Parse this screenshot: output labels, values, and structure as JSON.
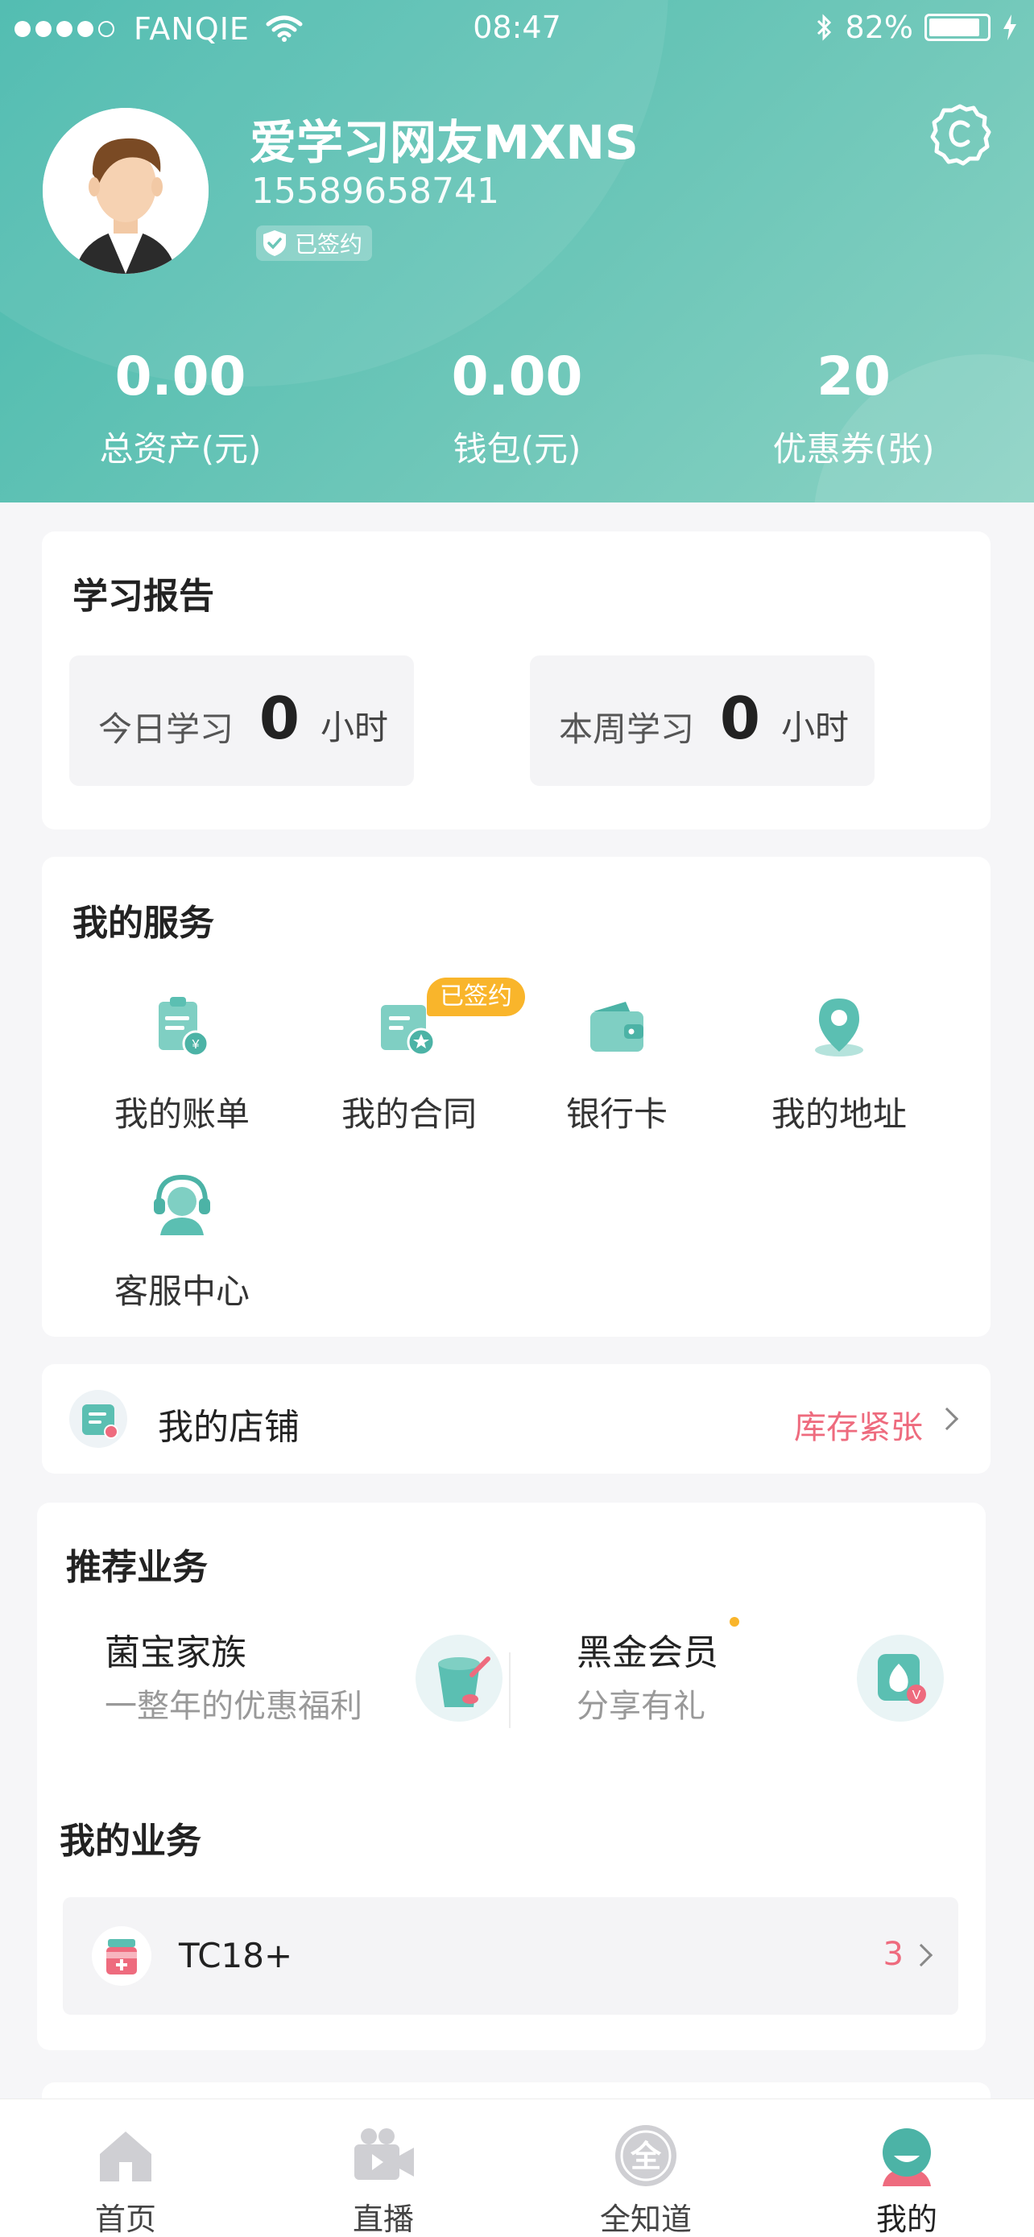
{
  "status_bar": {
    "carrier": "FANQIE",
    "time": "08:47",
    "battery": "82%"
  },
  "profile": {
    "name": "爱学习网友MXNS",
    "phone": "15589658741",
    "badge": "已签约"
  },
  "stats": [
    {
      "value": "0.00",
      "label": "总资产(元)"
    },
    {
      "value": "0.00",
      "label": "钱包(元)"
    },
    {
      "value": "20",
      "label": "优惠券(张)"
    }
  ],
  "study_report": {
    "title": "学习报告",
    "today": {
      "label": "今日学习",
      "value": "0",
      "unit": "小时"
    },
    "week": {
      "label": "本周学习",
      "value": "0",
      "unit": "小时"
    }
  },
  "services": {
    "title": "我的服务",
    "signed_tag": "已签约",
    "items": [
      {
        "label": "我的账单",
        "icon": "bill-icon"
      },
      {
        "label": "我的合同",
        "icon": "contract-icon"
      },
      {
        "label": "银行卡",
        "icon": "wallet-icon"
      },
      {
        "label": "我的地址",
        "icon": "location-icon"
      },
      {
        "label": "客服中心",
        "icon": "customer-service-icon"
      }
    ]
  },
  "store": {
    "label": "我的店铺",
    "status": "库存紧张"
  },
  "recommended": {
    "title": "推荐业务",
    "items": [
      {
        "title": "菌宝家族",
        "subtitle": "一整年的优惠福利"
      },
      {
        "title": "黑金会员",
        "subtitle": "分享有礼"
      }
    ]
  },
  "my_business": {
    "title": "我的业务",
    "item": {
      "label": "TC18+",
      "count": "3"
    }
  },
  "tabbar": [
    {
      "label": "首页",
      "icon": "home-icon"
    },
    {
      "label": "直播",
      "icon": "live-camera-icon"
    },
    {
      "label": "全知道",
      "icon": "quanzhidao-icon"
    },
    {
      "label": "我的",
      "icon": "profile-icon"
    }
  ],
  "colors": {
    "primary": "#5bbfb2",
    "accent_red": "#ee6b7e",
    "badge_orange": "#f9b52b"
  }
}
